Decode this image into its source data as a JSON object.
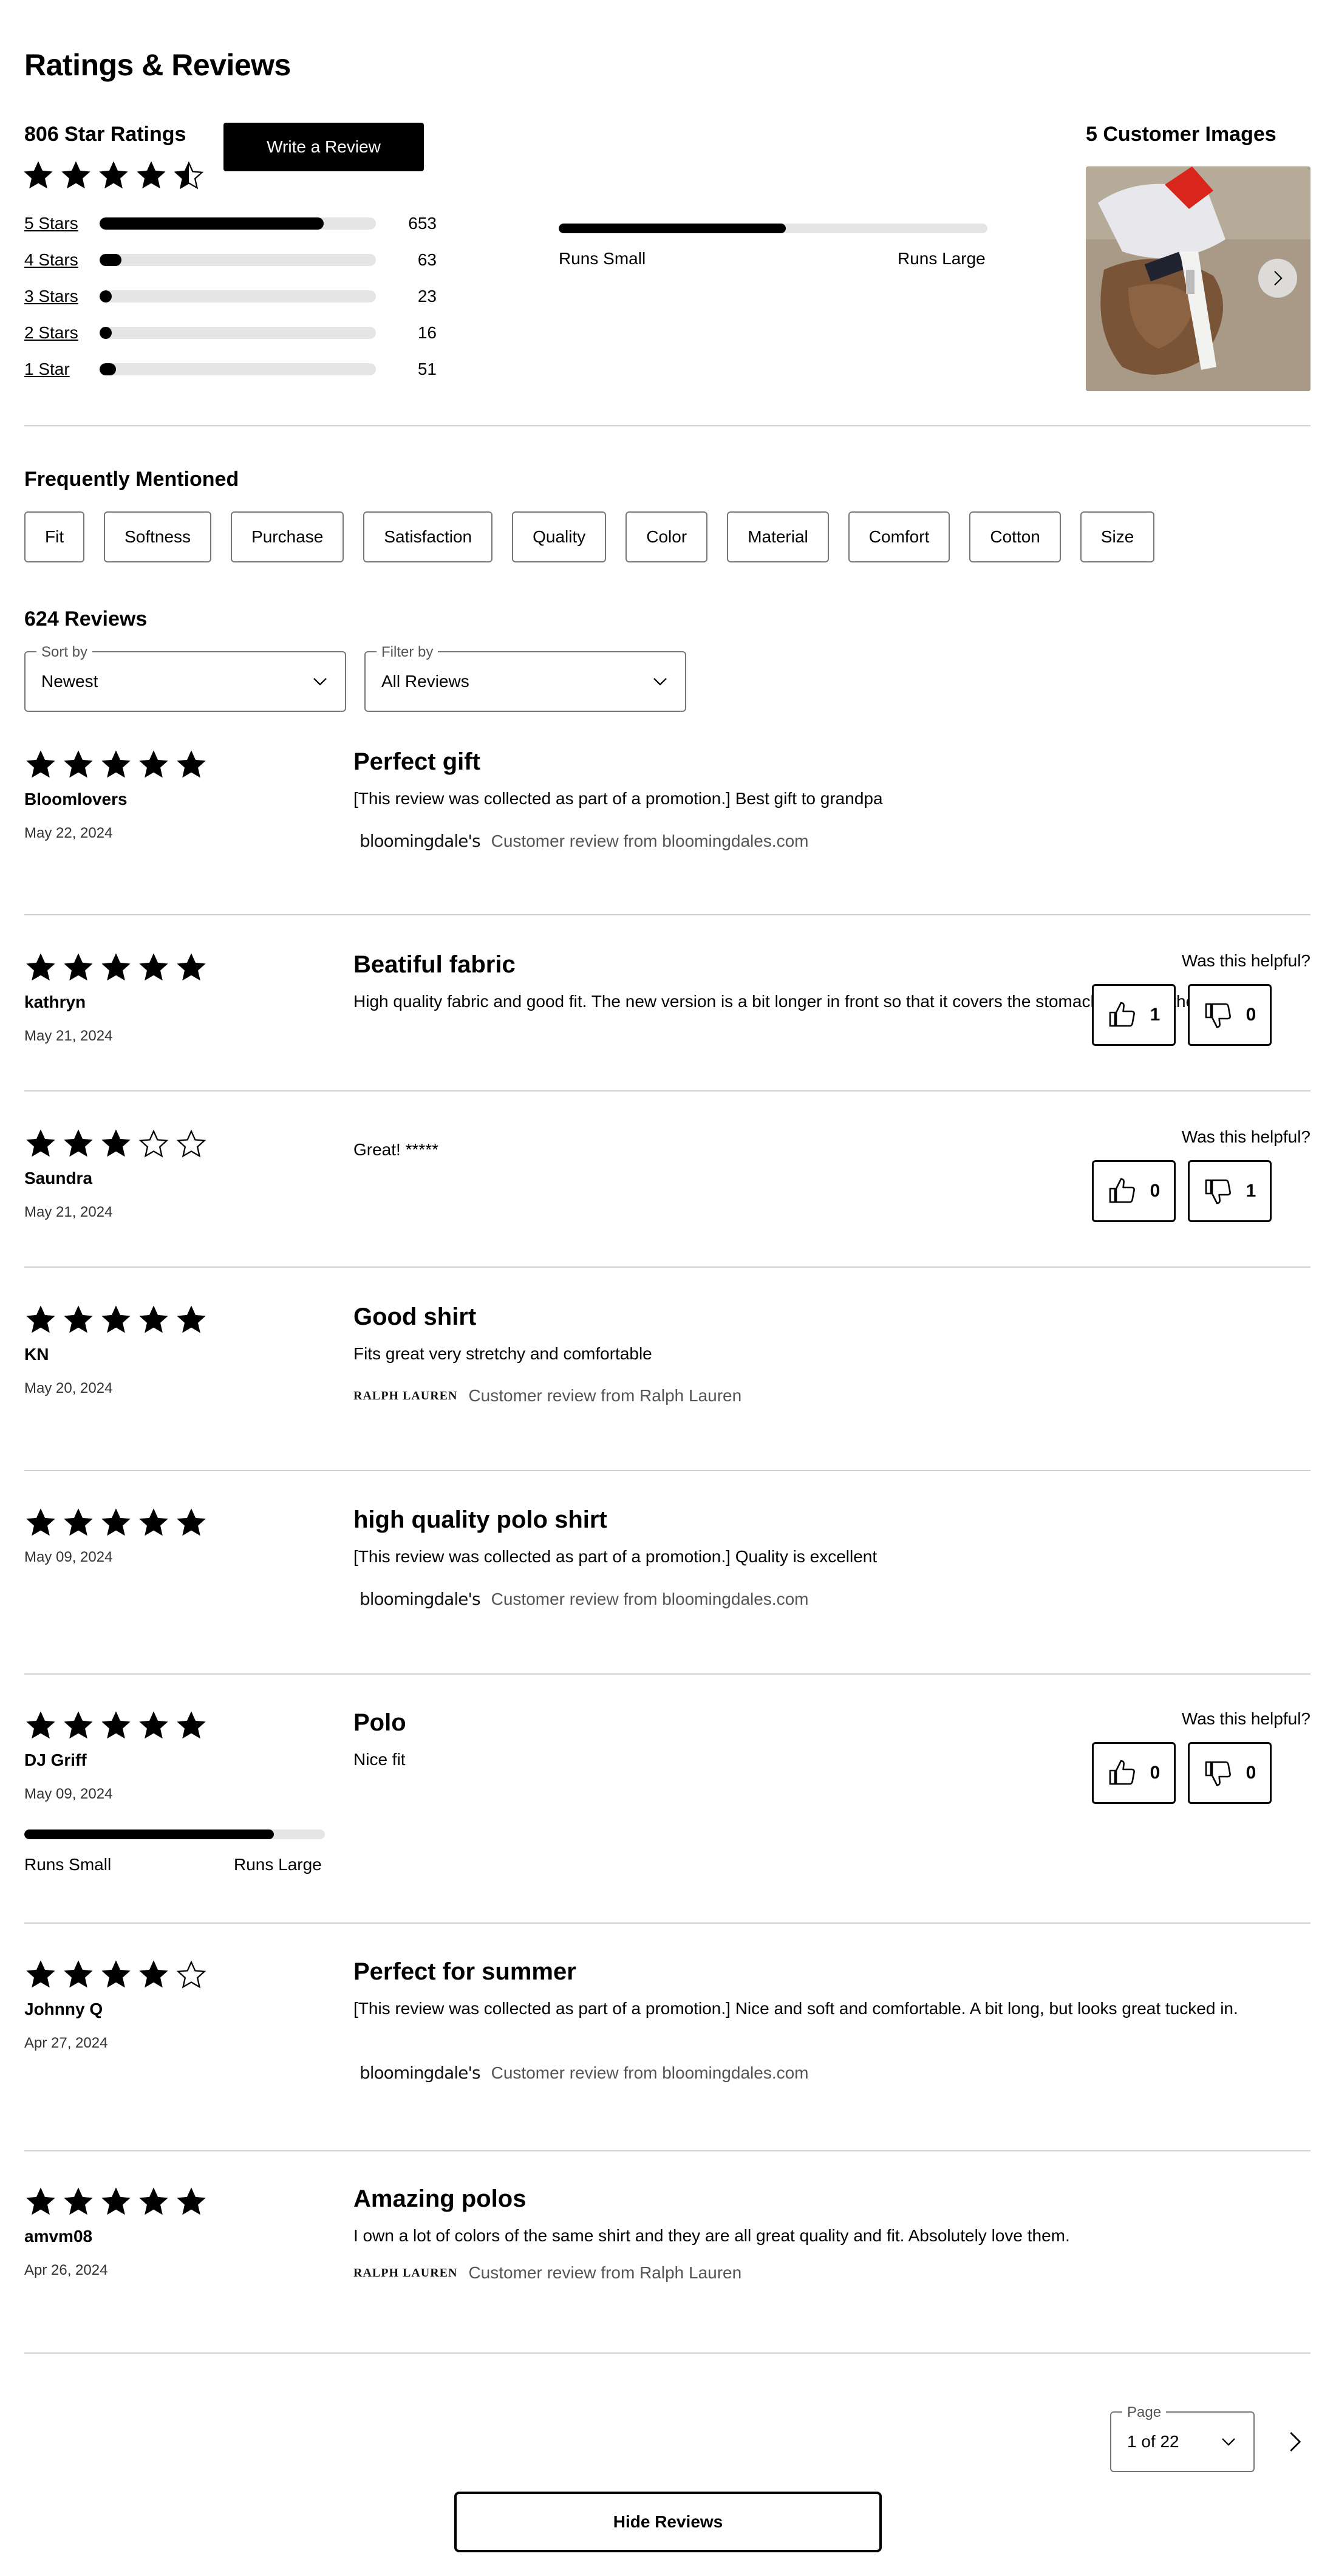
{
  "header": {
    "title": "Ratings & Reviews"
  },
  "summary": {
    "star_ratings_label": "806 Star Ratings",
    "average_rating": 4.5,
    "write_review_label": "Write a Review",
    "distribution": [
      {
        "label": "5 Stars",
        "count": "653",
        "fraction": 0.81
      },
      {
        "label": "4 Stars",
        "count": "63",
        "fraction": 0.08
      },
      {
        "label": "3 Stars",
        "count": "23",
        "fraction": 0.03
      },
      {
        "label": "2 Stars",
        "count": "16",
        "fraction": 0.02
      },
      {
        "label": "1 Star",
        "count": "51",
        "fraction": 0.06
      }
    ],
    "fit": {
      "min_label": "Runs Small",
      "max_label": "Runs Large",
      "fraction": 0.53
    },
    "images_title": "5 Customer Images"
  },
  "frequently_mentioned": {
    "title": "Frequently Mentioned",
    "tags": [
      "Fit",
      "Softness",
      "Purchase",
      "Satisfaction",
      "Quality",
      "Color",
      "Material",
      "Comfort",
      "Cotton",
      "Size"
    ]
  },
  "reviews_section": {
    "count_label": "624 Reviews",
    "sort": {
      "legend": "Sort by",
      "value": "Newest"
    },
    "filter": {
      "legend": "Filter by",
      "value": "All Reviews"
    }
  },
  "helpful_label": "Was this helpful?",
  "reviews": [
    {
      "rating": 5,
      "author": "Bloomlovers",
      "date": "May 22, 2024",
      "title": "Perfect gift",
      "body": "[This review was collected as part of a promotion.] Best gift to grandpa",
      "source_logo": "bloomingdale's",
      "source_text": "Customer review from bloomingdales.com"
    },
    {
      "rating": 5,
      "author": "kathryn",
      "date": "May 21, 2024",
      "title": "Beatiful fabric",
      "body": "High quality fabric and good fit. The new version is a bit longer in front so that it covers the stomach if you lift the arms.",
      "helpful_yes": "1",
      "helpful_no": "0"
    },
    {
      "rating": 3,
      "author": "Saundra",
      "date": "May 21, 2024",
      "title": "",
      "body": "Great! *****",
      "helpful_yes": "0",
      "helpful_no": "1"
    },
    {
      "rating": 5,
      "author": "KN",
      "date": "May 20, 2024",
      "title": "Good shirt",
      "body": "Fits great very stretchy and comfortable",
      "source_logo": "RALPH LAUREN",
      "source_text": "Customer review from Ralph Lauren"
    },
    {
      "rating": 5,
      "author": "",
      "date": "May 09, 2024",
      "title": "high quality polo shirt",
      "body": "[This review was collected as part of a promotion.] Quality is excellent",
      "source_logo": "bloomingdale's",
      "source_text": "Customer review from bloomingdales.com"
    },
    {
      "rating": 5,
      "author": "DJ Griff",
      "date": "May 09, 2024",
      "title": "Polo",
      "body": "Nice fit",
      "helpful_yes": "0",
      "helpful_no": "0",
      "fit": {
        "min_label": "Runs Small",
        "max_label": "Runs Large",
        "fraction": 0.83
      }
    },
    {
      "rating": 4,
      "author": "Johnny Q",
      "date": "Apr 27, 2024",
      "title": "Perfect for summer",
      "body": "[This review was collected as part of a promotion.] Nice and soft and comfortable. A bit long, but looks great tucked in.",
      "source_logo": "bloomingdale's",
      "source_text": "Customer review from bloomingdales.com"
    },
    {
      "rating": 5,
      "author": "amvm08",
      "date": "Apr 26, 2024",
      "title": "Amazing polos",
      "body": "I own a lot of colors of the same shirt and they are all great quality and fit. Absolutely love them.",
      "source_logo": "RALPH LAUREN",
      "source_text": "Customer review from Ralph Lauren"
    }
  ],
  "pagination": {
    "legend": "Page",
    "value": "1 of 22"
  },
  "hide_reviews_label": "Hide Reviews",
  "icons": {
    "star": "star-icon",
    "thumbs_up": "thumbs-up-icon",
    "thumbs_down": "thumbs-down-icon",
    "chevron_down": "chevron-down-icon",
    "chevron_right": "chevron-right-icon"
  }
}
